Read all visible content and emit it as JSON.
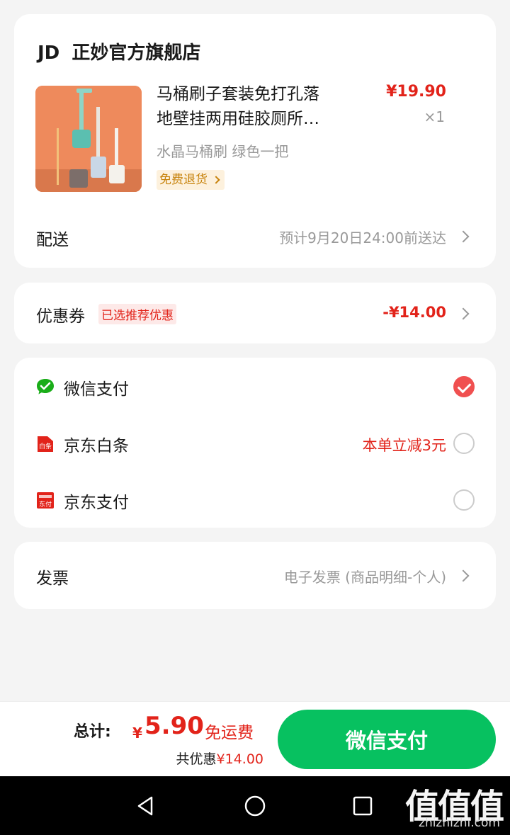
{
  "order": {
    "shop_logo": "JD",
    "shop_name": "正妙官方旗舰店",
    "product": {
      "title_line1": "马桶刷子套装免打孔落",
      "title_line2": "地壁挂两用硅胶厕所…",
      "price": "¥19.90",
      "quantity": "×1",
      "spec": "水晶马桶刷 绿色一把",
      "return_tag": "免费退货"
    },
    "delivery": {
      "label": "配送",
      "value": "预计9月20日24:00前送达"
    }
  },
  "coupon": {
    "label": "优惠券",
    "tag": "已选推荐优惠",
    "value": "-¥14.00"
  },
  "payment": {
    "methods": [
      {
        "label": "微信支付",
        "selected": true,
        "icon": "wechat-pay-icon"
      },
      {
        "label": "京东白条",
        "selected": false,
        "promo": "本单立减3元",
        "icon": "jd-baitiao-icon",
        "icon_text": "白条"
      },
      {
        "label": "京东支付",
        "selected": false,
        "icon": "jd-pay-icon",
        "icon_text": "东付"
      }
    ]
  },
  "invoice": {
    "label": "发票",
    "value": "电子发票 (商品明细-个人)"
  },
  "bottom_bar": {
    "total_label": "总计:",
    "currency": "¥",
    "total_amount": "5.90",
    "shipping": "免运费",
    "discount_label": "共优惠",
    "discount_amount": "¥14.00",
    "pay_button": "微信支付"
  },
  "watermark": {
    "logo": "值值值",
    "url": "zhizhizhi.com"
  },
  "colors": {
    "accent_red": "#e2231a",
    "wechat_green": "#07c160",
    "checked_red": "#f05050"
  }
}
